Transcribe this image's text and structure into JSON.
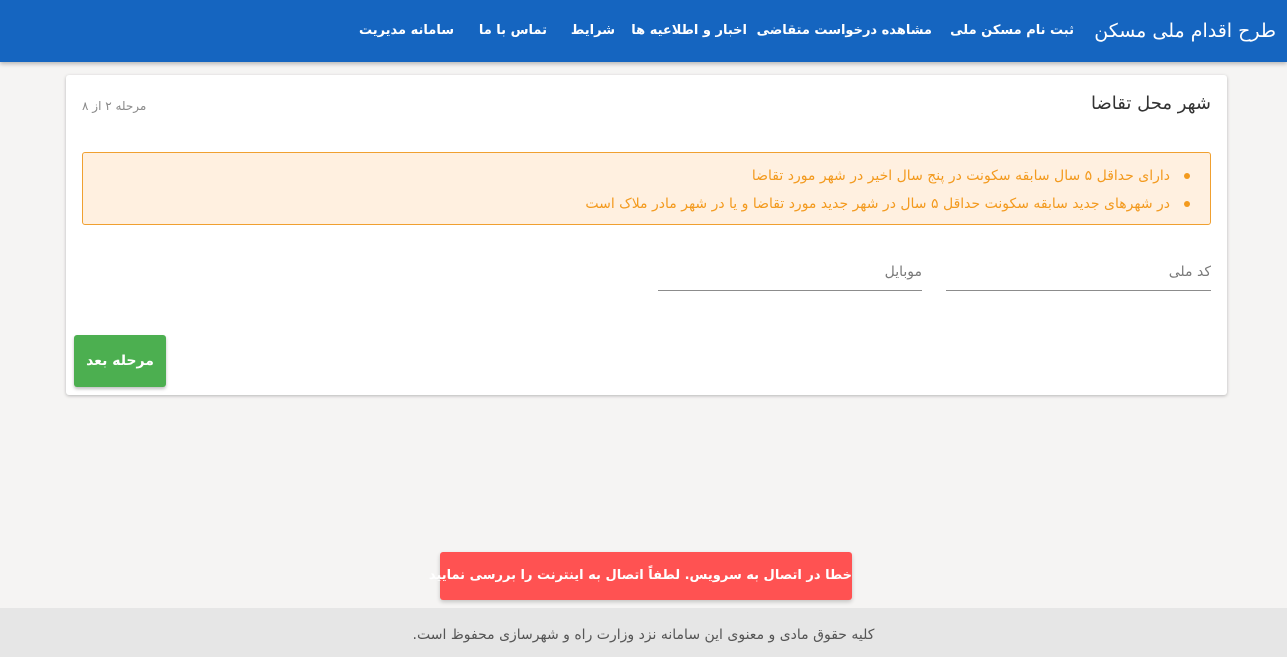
{
  "header": {
    "brand": "طرح اقدام ملی مسکن",
    "nav": [
      "ثبت نام مسکن ملی",
      "مشاهده درخواست متقاضی",
      "اخبار و اطلاعیه ها",
      "شرایط",
      "تماس با ما",
      "سامانه مدیریت"
    ],
    "colors": {
      "bar": "#1565c0"
    }
  },
  "card": {
    "title": "شهر محل تقاضا",
    "step": "مرحله ۲ از ۸",
    "alert_items": [
      "دارای حداقل ۵ سال سابقه سکونت در پنج سال اخیر در شهر مورد تقاضا",
      "در شهرهای جدید سابقه سکونت حداقل ۵ سال در شهر جدید مورد تقاضا و یا در شهر مادر ملاک است"
    ],
    "fields": {
      "national_code": {
        "placeholder": "کد ملی",
        "value": ""
      },
      "mobile": {
        "placeholder": "موبایل",
        "value": ""
      }
    },
    "next_button": "مرحله بعد",
    "colors": {
      "alert": "#f39a1e",
      "button": "#4caf50"
    }
  },
  "toast": {
    "message": "خطا در اتصال به سرویس. لطفاً اتصال به اینترنت را بررسی نمایید",
    "color": "#ff5252"
  },
  "footer": {
    "text": "کلیه حقوق مادی و معنوی این سامانه نزد وزارت راه و شهرسازی محفوظ است."
  }
}
